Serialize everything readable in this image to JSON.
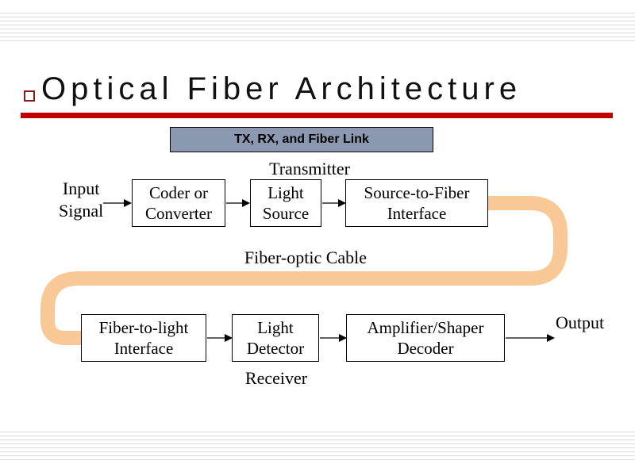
{
  "title": "Optical  Fiber  Architecture",
  "subtitle": "TX, RX, and Fiber Link",
  "transmitter_label": "Transmitter",
  "receiver_label": "Receiver",
  "fiber_label": "Fiber-optic Cable",
  "input_label": "Input\nSignal",
  "output_label": "Output",
  "tx": {
    "coder": "Coder or\nConverter",
    "light_source": "Light\nSource",
    "stf_interface": "Source-to-Fiber\nInterface"
  },
  "rx": {
    "ftl_interface": "Fiber-to-light\nInterface",
    "light_detector": "Light\nDetector",
    "amp_decoder": "Amplifier/Shaper\nDecoder"
  },
  "colors": {
    "accent_red": "#c00000",
    "subtitle_bg": "#8a98b0",
    "fiber": "#f8c996"
  }
}
